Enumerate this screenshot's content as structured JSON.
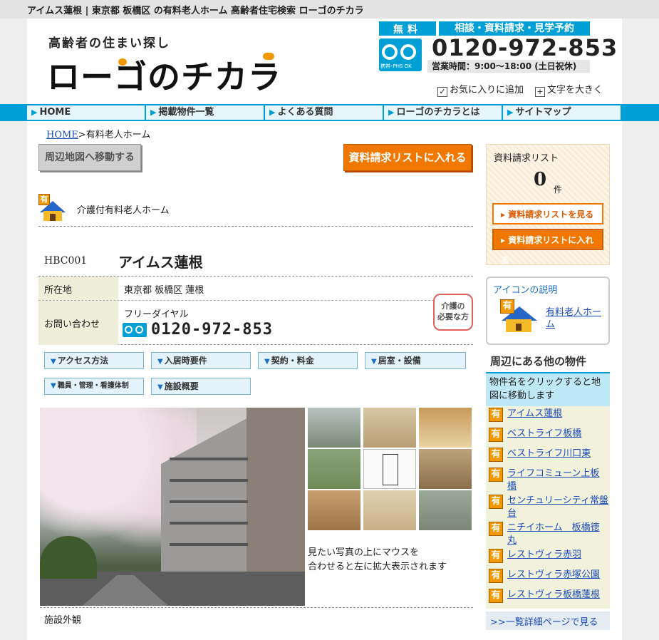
{
  "top_bar": {
    "text": "アイムス蓮根 | 東京都 板橋区 の有料老人ホーム 高齢者住宅検索 ローゴのチカラ"
  },
  "header": {
    "tagline": "高齢者の住まい探し",
    "logo": "ローゴのチカラ",
    "free_label": "無料",
    "services": "相談・資料請求・見学予約",
    "freedial_caption": "携帯･PHS OK",
    "phone": "0120-972-853",
    "hours": "営業時間：9:00〜18:00 (土日祝休)",
    "add_favorite": "お気に入りに追加",
    "enlarge_text": "文字を大きく"
  },
  "nav": {
    "items": [
      "HOME",
      "掲載物件一覧",
      "よくある質問",
      "ローゴのチカラとは",
      "サイトマップ"
    ]
  },
  "breadcrumb": {
    "home": "HOME",
    "sep": ">",
    "current": "有料老人ホーム"
  },
  "actions": {
    "map": "周辺地図へ移動する",
    "add_list": "資料請求リストに入れる"
  },
  "facility": {
    "type_badge": "有",
    "type": "介護付有料老人ホーム",
    "code": "HBC001",
    "name": "アイムス蓮根",
    "address_label": "所在地",
    "address": "東京都 板橋区 蓮根",
    "contact_label": "お問い合わせ",
    "contact_type": "フリーダイヤル",
    "phone": "0120-972-853",
    "care_badge_line1": "介護の",
    "care_badge_line2": "必要な方"
  },
  "section_tabs": [
    "アクセス方法",
    "入居時要件",
    "契約・料金",
    "居室・設備",
    "職員・管理・看護体制",
    "施設概要"
  ],
  "photos": {
    "hint_line1": "見たい写真の上にマウスを",
    "hint_line2": "合わせると左に拡大表示されます",
    "caption": "施設外観"
  },
  "request_list": {
    "title": "資料請求リスト",
    "count": "0",
    "unit": "件",
    "view_button": "資料請求リストを見る",
    "add_button": "資料請求リストに入れる"
  },
  "legend": {
    "title": "アイコンの説明",
    "badge": "有",
    "link": "有料老人ホーム"
  },
  "nearby": {
    "title": "周辺にある他の物件",
    "note": "物件名をクリックすると地図に移動します",
    "badge": "有",
    "items": [
      "アイムス蓮根",
      "ベストライフ板橋",
      "ベストライフ川口東",
      "ライフコミューン上板橋",
      "センチュリーシティ常盤台",
      "ニチイホーム　板橋徳丸",
      "レストヴィラ赤羽",
      "レストヴィラ赤塚公園",
      "レストヴィラ板橋蓮根"
    ],
    "more": ">>一覧詳細ページで見る"
  },
  "colors": {
    "accent": "#00a0d6",
    "orange": "#f07800",
    "badge": "#f39800"
  }
}
